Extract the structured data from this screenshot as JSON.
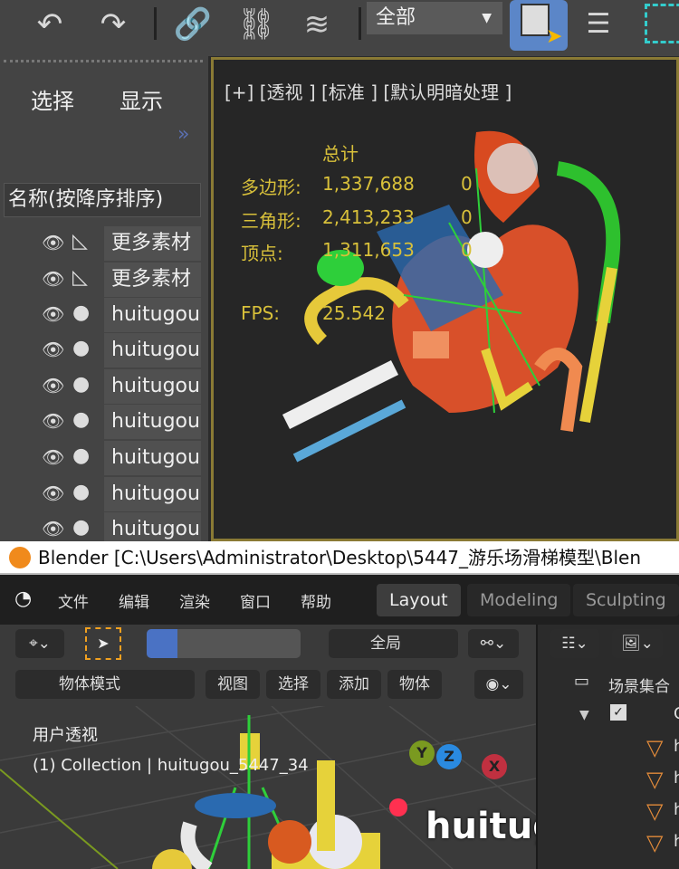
{
  "max": {
    "toolbar": {
      "undo": "undo-icon",
      "redo": "redo-icon",
      "selection_filter": "全部",
      "filter_arrow": "▼"
    },
    "scene_explorer": {
      "tabs": [
        "选择",
        "显示"
      ],
      "expand": "»",
      "column_header": "名称(按降序排序)",
      "rows": [
        "更多素材",
        "更多素材",
        "huitugou",
        "huitugou",
        "huitugou",
        "huitugou",
        "huitugou",
        "huitugou",
        "huitugou"
      ]
    },
    "viewport": {
      "label": "[+]  [透视 ]  [标准 ]  [默认明暗处理 ]",
      "stats": {
        "header": "总计",
        "polygons_label": "多边形:",
        "polygons": "1,337,688",
        "triangles_label": "三角形:",
        "triangles": "2,413,233",
        "vertices_label": "顶点:",
        "vertices": "1,311,653",
        "sel_polygons": "0",
        "sel_triangles": "0",
        "sel_vertices": "0",
        "fps_label": "FPS:",
        "fps": "25.542"
      }
    }
  },
  "blender": {
    "title": "Blender [C:\\Users\\Administrator\\Desktop\\5447_游乐场滑梯模型\\Blen",
    "menu": [
      "文件",
      "编辑",
      "渲染",
      "窗口",
      "帮助"
    ],
    "workspaces": [
      "Layout",
      "Modeling",
      "Sculpting"
    ],
    "transform_orientation": "全局",
    "mode": "物体模式",
    "header_menu": [
      "视图",
      "选择",
      "添加",
      "物体"
    ],
    "viewport": {
      "view_name": "用户透视",
      "collection_info": "(1) Collection | huitugou_5447_34",
      "axes": [
        "Y",
        "Z",
        "X"
      ]
    },
    "outliner": {
      "title": "场景集合",
      "collection": "C",
      "items": [
        "h",
        "h",
        "h",
        "h"
      ]
    },
    "watermark": "huitugou.com"
  }
}
